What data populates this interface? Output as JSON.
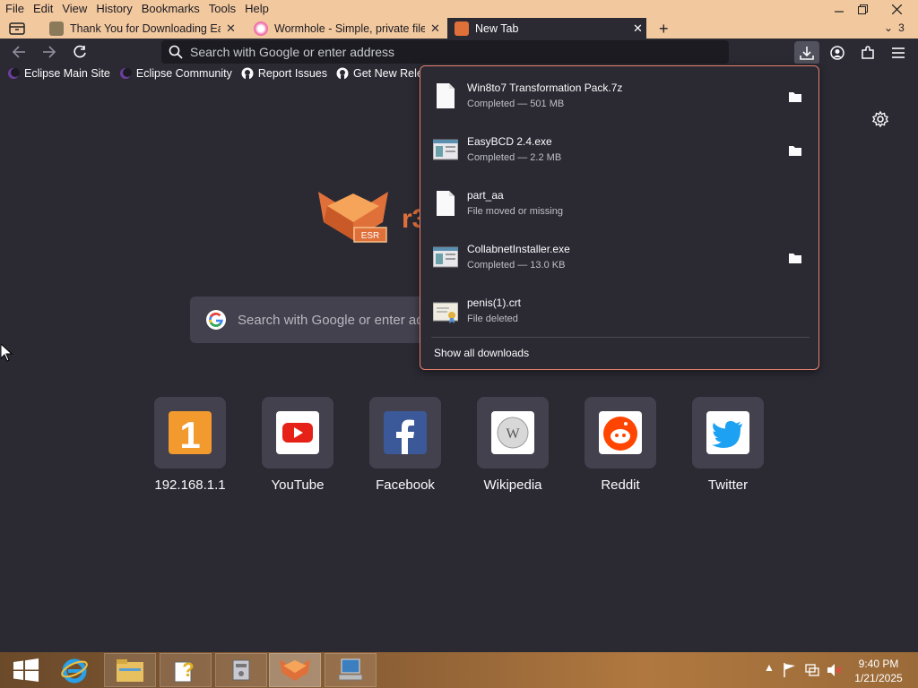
{
  "menubar": {
    "items": [
      "File",
      "Edit",
      "View",
      "History",
      "Bookmarks",
      "Tools",
      "Help"
    ]
  },
  "tabs": [
    {
      "title": "Thank You for Downloading Eas",
      "active": false
    },
    {
      "title": "Wormhole - Simple, private file",
      "active": false
    },
    {
      "title": "New Tab",
      "active": true
    }
  ],
  "tab_overflow_count": "3",
  "urlbar": {
    "placeholder": "Search with Google or enter address"
  },
  "bookmarks": [
    {
      "label": "Eclipse Main Site",
      "icon": "eclipse-icon"
    },
    {
      "label": "Eclipse Community",
      "icon": "eclipse-icon"
    },
    {
      "label": "Report Issues",
      "icon": "github-icon"
    },
    {
      "label": "Get New Releases",
      "icon": "github-icon"
    }
  ],
  "newtab": {
    "search_placeholder": "Search with Google or enter address",
    "logo_text": "r3",
    "logo_badge": "ESR",
    "tiles": [
      {
        "label": "192.168.1.1",
        "icon": "number-one-icon"
      },
      {
        "label": "YouTube",
        "icon": "youtube-icon"
      },
      {
        "label": "Facebook",
        "icon": "facebook-icon"
      },
      {
        "label": "Wikipedia",
        "icon": "wikipedia-icon"
      },
      {
        "label": "Reddit",
        "icon": "reddit-icon"
      },
      {
        "label": "Twitter",
        "icon": "twitter-icon"
      }
    ]
  },
  "downloads": {
    "items": [
      {
        "name": "Win8to7 Transformation Pack.7z",
        "status": "Completed — 501 MB",
        "icon": "file-icon",
        "has_folder": true
      },
      {
        "name": "EasyBCD 2.4.exe",
        "status": "Completed — 2.2 MB",
        "icon": "exe-icon",
        "has_folder": true
      },
      {
        "name": "part_aa",
        "status": "File moved or missing",
        "icon": "file-icon",
        "has_folder": false
      },
      {
        "name": "CollabnetInstaller.exe",
        "status": "Completed — 13.0 KB",
        "icon": "exe-icon",
        "has_folder": true
      },
      {
        "name": "penis(1).crt",
        "status": "File deleted",
        "icon": "certificate-icon",
        "has_folder": false
      }
    ],
    "show_all": "Show all downloads"
  },
  "taskbar": {
    "clock_time": "9:40 PM",
    "clock_date": "1/21/2025"
  },
  "colors": {
    "accent_titlebar": "#f2c89e",
    "panel_border": "#e8826f",
    "background": "#2b2a33"
  }
}
